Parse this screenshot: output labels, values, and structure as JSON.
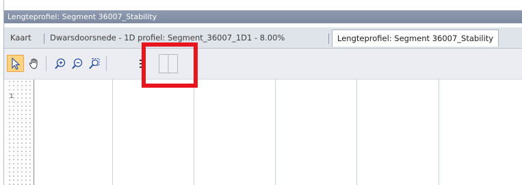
{
  "window": {
    "title": "Lengteprofiel: Segment 36007_Stability"
  },
  "tabs": [
    {
      "label": "Kaart",
      "active": false
    },
    {
      "label": "Dwarsdoorsnede - 1D profiel: Segment_36007_1D1 - 8.00%",
      "active": false
    },
    {
      "label": "Lengteprofiel: Segment 36007_Stability",
      "active": true
    }
  ],
  "toolbar": {
    "tools": [
      {
        "name": "select-pointer",
        "icon": "cursor-arrow-icon",
        "selected": true
      },
      {
        "name": "pan",
        "icon": "hand-icon",
        "selected": false
      },
      {
        "name": "zoom-in",
        "icon": "zoom-in-icon",
        "selected": false
      },
      {
        "name": "zoom-out",
        "icon": "zoom-out-icon",
        "selected": false
      },
      {
        "name": "zoom-extent",
        "icon": "zoom-extent-icon",
        "selected": false
      },
      {
        "name": "legend",
        "icon": "list-icon",
        "selected": false
      },
      {
        "name": "split-view",
        "icon": "split-panel-icon",
        "selected": false
      }
    ]
  },
  "canvas": {
    "ruler_label": "1"
  },
  "colors": {
    "title_bg": "#8392a8",
    "tab_bg": "#dfe3ea",
    "highlight": "#e8141e",
    "selected_tool": "#ffd37f"
  }
}
